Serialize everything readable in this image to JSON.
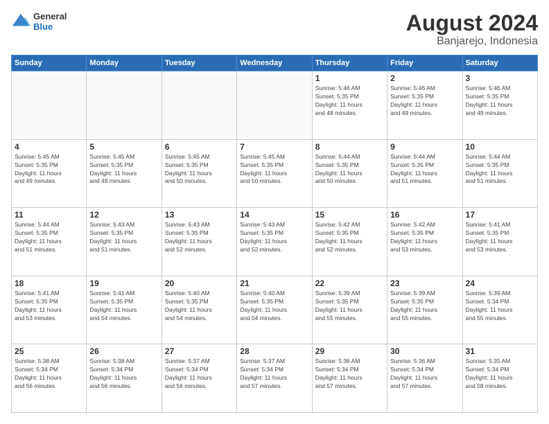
{
  "header": {
    "logo": {
      "general": "General",
      "blue": "Blue"
    },
    "title": "August 2024",
    "location": "Banjarejo, Indonesia"
  },
  "weekdays": [
    "Sunday",
    "Monday",
    "Tuesday",
    "Wednesday",
    "Thursday",
    "Friday",
    "Saturday"
  ],
  "weeks": [
    [
      {
        "day": "",
        "info": ""
      },
      {
        "day": "",
        "info": ""
      },
      {
        "day": "",
        "info": ""
      },
      {
        "day": "",
        "info": ""
      },
      {
        "day": "1",
        "info": "Sunrise: 5:46 AM\nSunset: 5:35 PM\nDaylight: 11 hours\nand 48 minutes."
      },
      {
        "day": "2",
        "info": "Sunrise: 5:46 AM\nSunset: 5:35 PM\nDaylight: 11 hours\nand 49 minutes."
      },
      {
        "day": "3",
        "info": "Sunrise: 5:46 AM\nSunset: 5:35 PM\nDaylight: 11 hours\nand 49 minutes."
      }
    ],
    [
      {
        "day": "4",
        "info": "Sunrise: 5:45 AM\nSunset: 5:35 PM\nDaylight: 11 hours\nand 49 minutes."
      },
      {
        "day": "5",
        "info": "Sunrise: 5:45 AM\nSunset: 5:35 PM\nDaylight: 11 hours\nand 49 minutes."
      },
      {
        "day": "6",
        "info": "Sunrise: 5:45 AM\nSunset: 5:35 PM\nDaylight: 11 hours\nand 50 minutes."
      },
      {
        "day": "7",
        "info": "Sunrise: 5:45 AM\nSunset: 5:35 PM\nDaylight: 11 hours\nand 50 minutes."
      },
      {
        "day": "8",
        "info": "Sunrise: 5:44 AM\nSunset: 5:35 PM\nDaylight: 11 hours\nand 50 minutes."
      },
      {
        "day": "9",
        "info": "Sunrise: 5:44 AM\nSunset: 5:35 PM\nDaylight: 11 hours\nand 51 minutes."
      },
      {
        "day": "10",
        "info": "Sunrise: 5:44 AM\nSunset: 5:35 PM\nDaylight: 11 hours\nand 51 minutes."
      }
    ],
    [
      {
        "day": "11",
        "info": "Sunrise: 5:44 AM\nSunset: 5:35 PM\nDaylight: 11 hours\nand 51 minutes."
      },
      {
        "day": "12",
        "info": "Sunrise: 5:43 AM\nSunset: 5:35 PM\nDaylight: 11 hours\nand 51 minutes."
      },
      {
        "day": "13",
        "info": "Sunrise: 5:43 AM\nSunset: 5:35 PM\nDaylight: 11 hours\nand 52 minutes."
      },
      {
        "day": "14",
        "info": "Sunrise: 5:43 AM\nSunset: 5:35 PM\nDaylight: 11 hours\nand 52 minutes."
      },
      {
        "day": "15",
        "info": "Sunrise: 5:42 AM\nSunset: 5:35 PM\nDaylight: 11 hours\nand 52 minutes."
      },
      {
        "day": "16",
        "info": "Sunrise: 5:42 AM\nSunset: 5:35 PM\nDaylight: 11 hours\nand 53 minutes."
      },
      {
        "day": "17",
        "info": "Sunrise: 5:41 AM\nSunset: 5:35 PM\nDaylight: 11 hours\nand 53 minutes."
      }
    ],
    [
      {
        "day": "18",
        "info": "Sunrise: 5:41 AM\nSunset: 5:35 PM\nDaylight: 11 hours\nand 53 minutes."
      },
      {
        "day": "19",
        "info": "Sunrise: 5:41 AM\nSunset: 5:35 PM\nDaylight: 11 hours\nand 54 minutes."
      },
      {
        "day": "20",
        "info": "Sunrise: 5:40 AM\nSunset: 5:35 PM\nDaylight: 11 hours\nand 54 minutes."
      },
      {
        "day": "21",
        "info": "Sunrise: 5:40 AM\nSunset: 5:35 PM\nDaylight: 11 hours\nand 54 minutes."
      },
      {
        "day": "22",
        "info": "Sunrise: 5:39 AM\nSunset: 5:35 PM\nDaylight: 11 hours\nand 55 minutes."
      },
      {
        "day": "23",
        "info": "Sunrise: 5:39 AM\nSunset: 5:35 PM\nDaylight: 11 hours\nand 55 minutes."
      },
      {
        "day": "24",
        "info": "Sunrise: 5:39 AM\nSunset: 5:34 PM\nDaylight: 11 hours\nand 55 minutes."
      }
    ],
    [
      {
        "day": "25",
        "info": "Sunrise: 5:38 AM\nSunset: 5:34 PM\nDaylight: 11 hours\nand 56 minutes."
      },
      {
        "day": "26",
        "info": "Sunrise: 5:38 AM\nSunset: 5:34 PM\nDaylight: 11 hours\nand 56 minutes."
      },
      {
        "day": "27",
        "info": "Sunrise: 5:37 AM\nSunset: 5:34 PM\nDaylight: 11 hours\nand 56 minutes."
      },
      {
        "day": "28",
        "info": "Sunrise: 5:37 AM\nSunset: 5:34 PM\nDaylight: 11 hours\nand 57 minutes."
      },
      {
        "day": "29",
        "info": "Sunrise: 5:36 AM\nSunset: 5:34 PM\nDaylight: 11 hours\nand 57 minutes."
      },
      {
        "day": "30",
        "info": "Sunrise: 5:36 AM\nSunset: 5:34 PM\nDaylight: 11 hours\nand 57 minutes."
      },
      {
        "day": "31",
        "info": "Sunrise: 5:35 AM\nSunset: 5:34 PM\nDaylight: 11 hours\nand 58 minutes."
      }
    ]
  ]
}
